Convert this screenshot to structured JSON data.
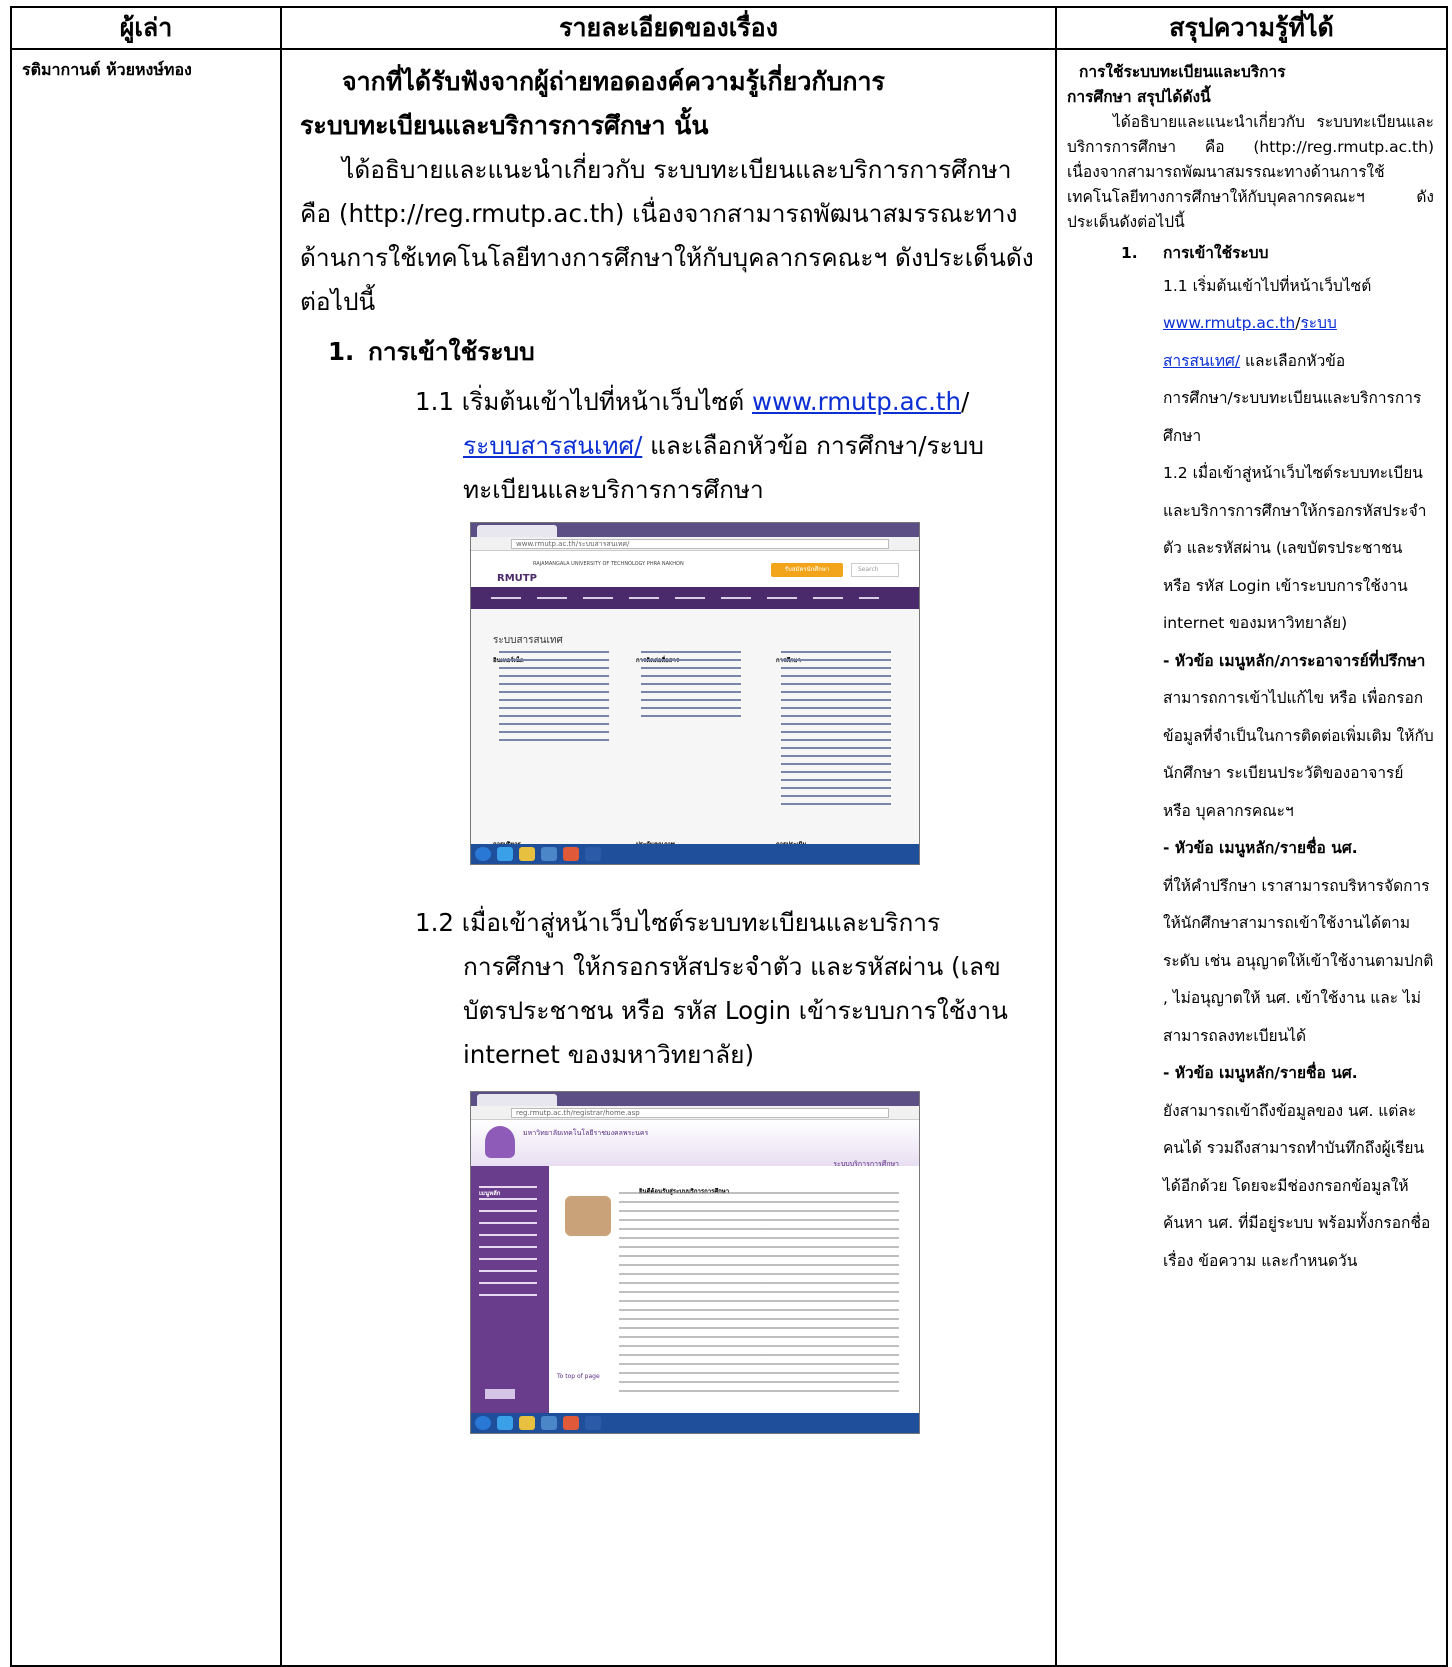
{
  "header": {
    "col1": "ผู้เล่า",
    "col2": "รายละเอียดของเรื่อง",
    "col3": "สรุปความรู้ที่ได้"
  },
  "narrator": "รติมากานต์  ห้วยหงษ์ทอง",
  "main": {
    "title_line1": "จากที่ได้รับฟังจากผู้ถ่ายทอดองค์ความรู้เกี่ยวกับการ",
    "title_line2": "ระบบทะเบียนและบริการการศึกษา นั้น",
    "intro": "ได้อธิบายและแนะนำเกี่ยวกับ  ระบบทะเบียนและบริการการศึกษา คือ  (http://reg.rmutp.ac.th) เนื่องจากสามารถพัฒนาสมรรณะทางด้านการใช้เทคโนโลยีทางการศึกษาให้กับบุคลากรคณะฯ ดังประเด็นดังต่อไปนี้",
    "section_num": "1.",
    "section_title": "การเข้าใช้ระบบ",
    "step1_prefix": "1.1 เริ่มต้นเข้าไปที่หน้าเว็บไซต์ ",
    "step1_link1": "www.rmutp.ac.th",
    "step1_slash": "/",
    "step1_link2": "ระบบสารสนเทศ/",
    "step1_rest": " และเลือกหัวข้อ การศึกษา/ระบบทะเบียนและบริการการศึกษา",
    "step2_line1": "1.2 เมื่อเข้าสู่หน้าเว็บไซต์ระบบทะเบียนและบริการ",
    "step2_rest": "การศึกษา ให้กรอกรหัสประจำตัว และรหัสผ่าน (เลขบัตรประชาชน หรือ รหัส Login เข้าระบบการใช้งาน internet ของมหาวิทยาลัย)"
  },
  "screenshot1": {
    "url": "www.rmutp.ac.th/ระบบสารสนเทศ/",
    "brand": "RMUTP",
    "brand_sub": "RAJAMANGALA UNIVERSITY OF TECHNOLOGY PHRA NAKHON",
    "button": "รับสมัครนักศึกษา",
    "search": "Search",
    "heading": "ระบบสารสนเทศ",
    "col_a": "อินเทอร์เน็ต",
    "col_b": "การติดต่อสื่อสาร",
    "col_c": "การศึกษา",
    "col_a2": "การบริหาร",
    "col_b2": "ประกันคุณภาพ",
    "col_c2": "การประเมิน",
    "purple": "#4b2a6b",
    "accent": "#f2a51a"
  },
  "screenshot2": {
    "url": "reg.rmutp.ac.th/registrar/home.asp",
    "uni": "มหาวิทยาลัยเทคโนโลยีราชมงคลพระนคร",
    "system": "ระบบบริการการศึกษา",
    "menu_title": "เมนูหลัก",
    "announce": "ยินดีต้อนรับสู่ระบบบริการการศึกษา",
    "back_top": "To top of page",
    "purple": "#6a3c8c"
  },
  "summary": {
    "title_line1": "การใช้ระบบทะเบียนและบริการ",
    "title_line2": "การศึกษา สรุปได้ดังนี้",
    "intro": "ได้อธิบายและแนะนำเกี่ยวกับ  ระบบทะเบียนและบริการการศึกษา คือ (http://reg.rmutp.ac.th) เนื่องจากสามารถพัฒนาสมรรณะทางด้านการใช้เทคโนโลยีทางการศึกษาให้กับบุคลากรคณะฯ ดังประเด็นดังต่อไปนี้",
    "section_num": "1.",
    "section_title": "การเข้าใช้ระบบ",
    "s11_text": "1.1 เริ่มต้นเข้าไปที่หน้าเว็บไซต์",
    "s11_link1": "www.rmutp.ac.th",
    "s11_slash": "/",
    "s11_link2a": "ระบบ",
    "s11_link2b": "สารสนเทศ/",
    "s11_rest": " และเลือกหัวข้อ",
    "s11_rest2": "การศึกษา/ระบบทะเบียนและบริการการศึกษา",
    "s12": "1.2 เมื่อเข้าสู่หน้าเว็บไซต์ระบบทะเบียนและบริการการศึกษาให้กรอกรหัสประจำตัว และรหัสผ่าน (เลขบัตรประชาชน หรือ รหัส Login เข้าระบบการใช้งาน internet ของมหาวิทยาลัย)",
    "b1_label": "- หัวข้อ เมนูหลัก/ภาระอาจารย์ที่ปรึกษา",
    "b1_text": " สามารถการเข้าไปแก้ไข หรือ เพื่อกรอกข้อมูลที่จำเป็นในการติดต่อเพิ่มเติม ให้กับนักศึกษา ระเบียนประวัติของอาจารย์ หรือ บุคลากรคณะฯ",
    "b2_label": "- หัวข้อ เมนูหลัก/รายชื่อ นศ.",
    "b2_text": "ที่ให้คำปรึกษา เราสามารถบริหารจัดการให้นักศึกษาสามารถเข้าใช้งานได้ตามระดับ เช่น อนุญาตให้เข้าใช้งานตามปกติ , ไม่อนุญาตให้ นศ. เข้าใช้งาน และ ไม่สามารถลงทะเบียนได้",
    "b3_label": "- หัวข้อ เมนูหลัก/รายชื่อ นศ.",
    "b3_text": "ยังสามารถเข้าถึงข้อมูลของ นศ. แต่ละคนได้ รวมถึงสามารถทำบันทึกถึงผู้เรียนได้อีกด้วย โดยจะมีช่องกรอกข้อมูลให้ค้นหา นศ. ที่มีอยู่ระบบ พร้อมทั้งกรอกชื่อเรื่อง ข้อความ และกำหนดวัน"
  }
}
